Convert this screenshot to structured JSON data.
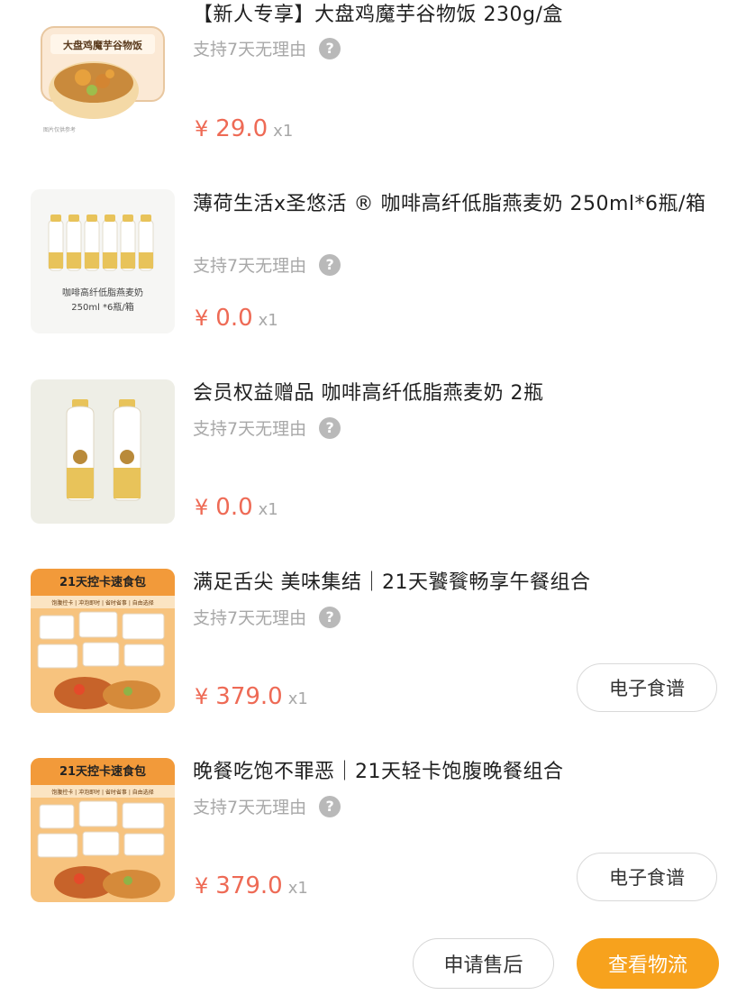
{
  "items": [
    {
      "title": "【新人专享】大盘鸡魔芋谷物饭 230g/盒",
      "policy": "支持7天无理由",
      "price_symbol": "¥",
      "price": "29.0",
      "qty": "x1",
      "thumb_caption": "大盘鸡魔芋谷物饭",
      "thumb_icon": "rice-bowl-image"
    },
    {
      "title": "薄荷生活x圣悠活 ® 咖啡高纤低脂燕麦奶 250ml*6瓶/箱",
      "policy": "支持7天无理由",
      "price_symbol": "¥",
      "price": "0.0",
      "qty": "x1",
      "thumb_caption1": "咖啡高纤低脂燕麦奶",
      "thumb_caption2": "250ml *6瓶/箱",
      "thumb_icon": "oat-milk-six-bottles-image"
    },
    {
      "title": "会员权益赠品 咖啡高纤低脂燕麦奶 2瓶",
      "policy": "支持7天无理由",
      "price_symbol": "¥",
      "price": "0.0",
      "qty": "x1",
      "thumb_icon": "oat-milk-two-bottles-image"
    },
    {
      "title": "满足舌尖 美味集结｜21天饕餮畅享午餐组合",
      "policy": "支持7天无理由",
      "price_symbol": "¥",
      "price": "379.0",
      "qty": "x1",
      "recipe": "电子食谱",
      "thumb_caption1": "21天控卡速食包",
      "thumb_caption2": "饱腹控卡 | 冲泡即时 | 省时省事 | 自由选择",
      "thumb_icon": "meal-pack-image"
    },
    {
      "title": "晚餐吃饱不罪恶｜21天轻卡饱腹晚餐组合",
      "policy": "支持7天无理由",
      "price_symbol": "¥",
      "price": "379.0",
      "qty": "x1",
      "recipe": "电子食谱",
      "thumb_caption1": "21天控卡速食包",
      "thumb_caption2": "饱腹控卡 | 冲泡即时 | 省时省事 | 自由选择",
      "thumb_icon": "meal-pack-image"
    }
  ],
  "actions": {
    "after_sale": "申请售后",
    "view_logistics": "查看物流"
  },
  "colors": {
    "price": "#ee6a55",
    "accent": "#f7a21d",
    "muted": "#a8a8a8"
  }
}
